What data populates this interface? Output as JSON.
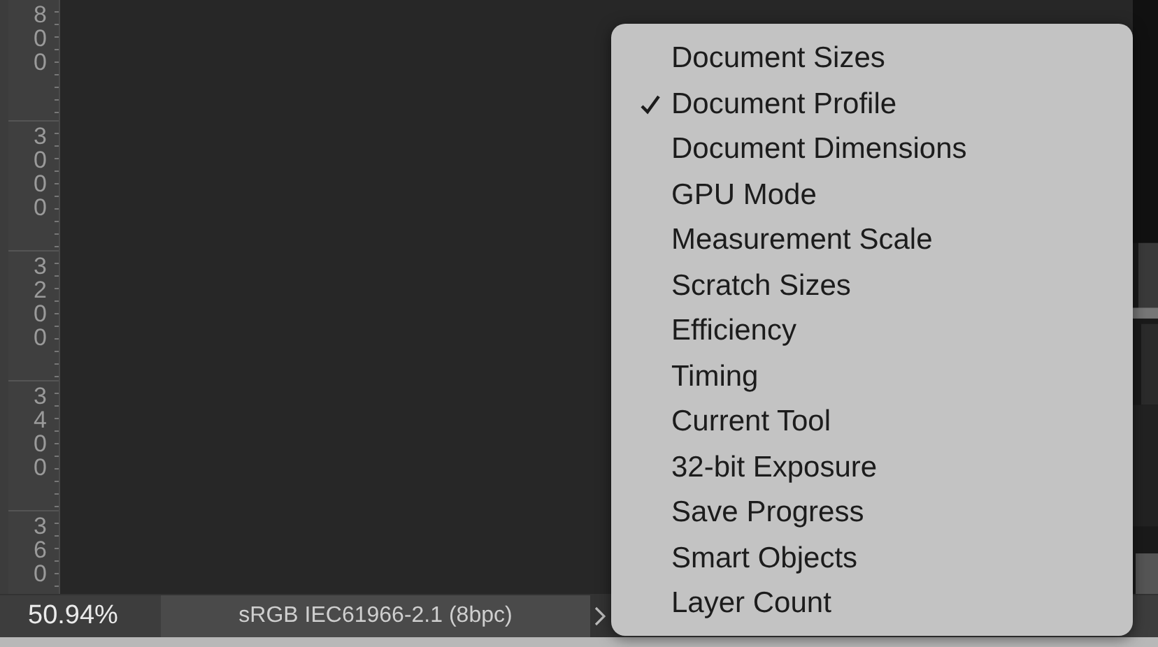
{
  "ruler": {
    "labels": [
      "800",
      "3000",
      "3200",
      "3400",
      "360"
    ]
  },
  "status_bar": {
    "zoom": "50.94%",
    "info": "sRGB IEC61966-2.1 (8bpc)"
  },
  "menu": {
    "items": [
      {
        "label": "Document Sizes",
        "selected": false
      },
      {
        "label": "Document Profile",
        "selected": true
      },
      {
        "label": "Document Dimensions",
        "selected": false
      },
      {
        "label": "GPU Mode",
        "selected": false
      },
      {
        "label": "Measurement Scale",
        "selected": false
      },
      {
        "label": "Scratch Sizes",
        "selected": false
      },
      {
        "label": "Efficiency",
        "selected": false
      },
      {
        "label": "Timing",
        "selected": false
      },
      {
        "label": "Current Tool",
        "selected": false
      },
      {
        "label": "32-bit Exposure",
        "selected": false
      },
      {
        "label": "Save Progress",
        "selected": false
      },
      {
        "label": "Smart Objects",
        "selected": false
      },
      {
        "label": "Layer Count",
        "selected": false
      }
    ]
  }
}
